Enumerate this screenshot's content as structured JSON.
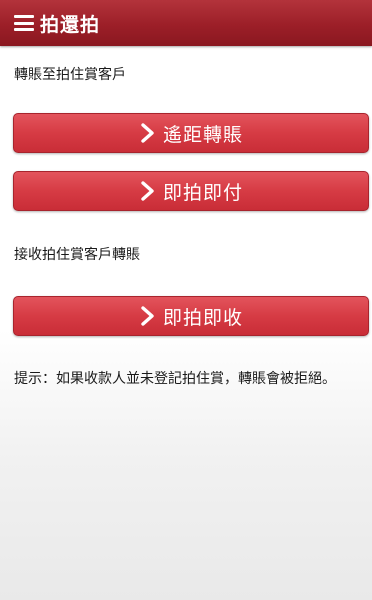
{
  "header": {
    "title": "拍還拍",
    "menu_icon": "hamburger-menu-icon"
  },
  "colors": {
    "header_bg": "#9c1f28",
    "button_bg": "#d63b44",
    "button_text": "#ffffff"
  },
  "transfer_section": {
    "label": "轉賬至拍住賞客戶",
    "buttons": [
      {
        "label": "遙距轉賬",
        "icon": "chevron-right-icon"
      },
      {
        "label": "即拍即付",
        "icon": "chevron-right-icon"
      }
    ]
  },
  "receive_section": {
    "label": "接收拍住賞客戶轉賬",
    "buttons": [
      {
        "label": "即拍即收",
        "icon": "chevron-right-icon"
      }
    ]
  },
  "hint": {
    "text": "提示：如果收款人並未登記拍住賞，轉賬會被拒絕。"
  }
}
